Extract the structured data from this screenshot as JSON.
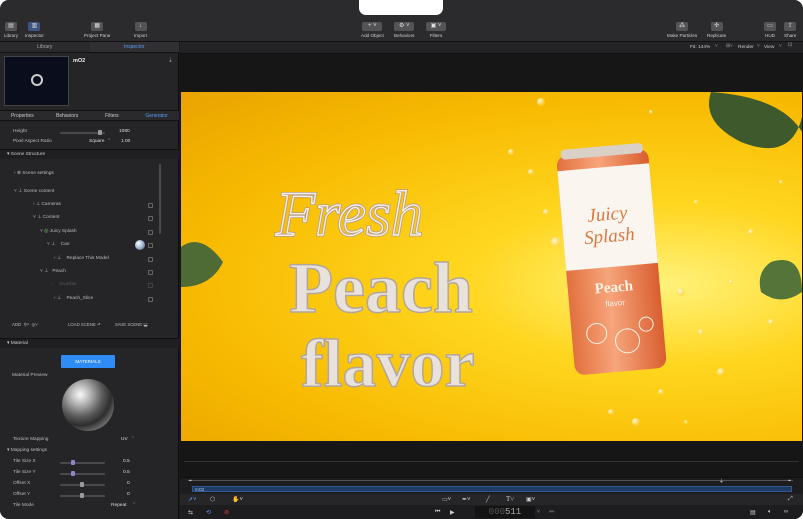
{
  "toolbar": {
    "library": "Library",
    "inspector": "Inspector",
    "project_pane": "Project Pane",
    "import": "Import",
    "add_object": "Add Object",
    "behaviors": "Behaviors",
    "filters": "Filters",
    "make_particles": "Make Particles",
    "replicate": "Replicate",
    "hud": "HUD",
    "share": "Share"
  },
  "panel_tabs": {
    "library": "Library",
    "inspector": "Inspector"
  },
  "selected_item": "mO2",
  "inspector_tabs": [
    "Properties",
    "Behaviors",
    "Filters",
    "Generator"
  ],
  "params": {
    "height_label": "Height",
    "height_value": "1080",
    "aspect_label": "Pixel Aspect Ratio",
    "aspect_value": "Square",
    "aspect_num": "1.00"
  },
  "scene": {
    "section": "Scene Structure",
    "settings": "Scene settings",
    "content_root": "Scene content",
    "items": {
      "cameras": "Cameras",
      "content": "Content",
      "juicy_splash": "Juicy Splash",
      "can": "Can",
      "replace": "Replace This Model",
      "peach": "Peach",
      "invisible": "Invisible",
      "peach_slice": "Peach_Slice"
    },
    "add": "ADD",
    "load_scene": "LOAD SCENE",
    "save_scene": "SAVE SCENE"
  },
  "material": {
    "section": "Material",
    "button": "MATERIALS",
    "preview_label": "Material Preview",
    "texture_mapping_label": "Texture Mapping",
    "texture_mapping_value": "UV",
    "mapping_section": "Mapping settings",
    "tile_size_x_label": "Tile Size X",
    "tile_size_x_value": "0.5",
    "tile_size_y_label": "Tile Size Y",
    "tile_size_y_value": "0.5",
    "offset_x_label": "Offset X",
    "offset_x_value": "0",
    "offset_y_label": "Offset Y",
    "offset_y_value": "0",
    "tile_mode_label": "Tile Mode",
    "tile_mode_value": "Repeat"
  },
  "viewer": {
    "fit": "Fit: 144%",
    "render": "Render",
    "view": "View"
  },
  "canvas": {
    "fresh": "Fresh",
    "peach": "Peach",
    "flavor": "flavor",
    "can_brand_1": "Juicy",
    "can_brand_2": "Splash",
    "can_peach": "Peach",
    "can_flavor": "flavor"
  },
  "timeline": {
    "clip_label": "mO2",
    "frame": "511"
  },
  "colors": {
    "accent": "#2f8cf4",
    "canvas_yellow": "#f7b900",
    "can_orange": "#f08a55"
  }
}
